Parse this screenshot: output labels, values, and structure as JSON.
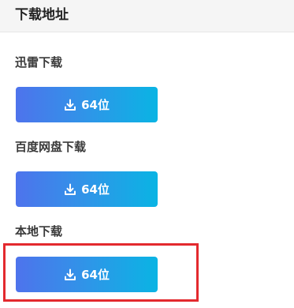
{
  "header": {
    "title": "下载地址"
  },
  "sections": [
    {
      "label": "迅雷下载",
      "button_label": "64位"
    },
    {
      "label": "百度网盘下载",
      "button_label": "64位"
    },
    {
      "label": "本地下载",
      "button_label": "64位"
    }
  ],
  "icons": {
    "download": "download-icon"
  },
  "colors": {
    "button_gradient_start": "#4e73ec",
    "button_gradient_end": "#0ab4e4",
    "highlight": "#e3292e",
    "header_bg": "#f5f5f5"
  }
}
